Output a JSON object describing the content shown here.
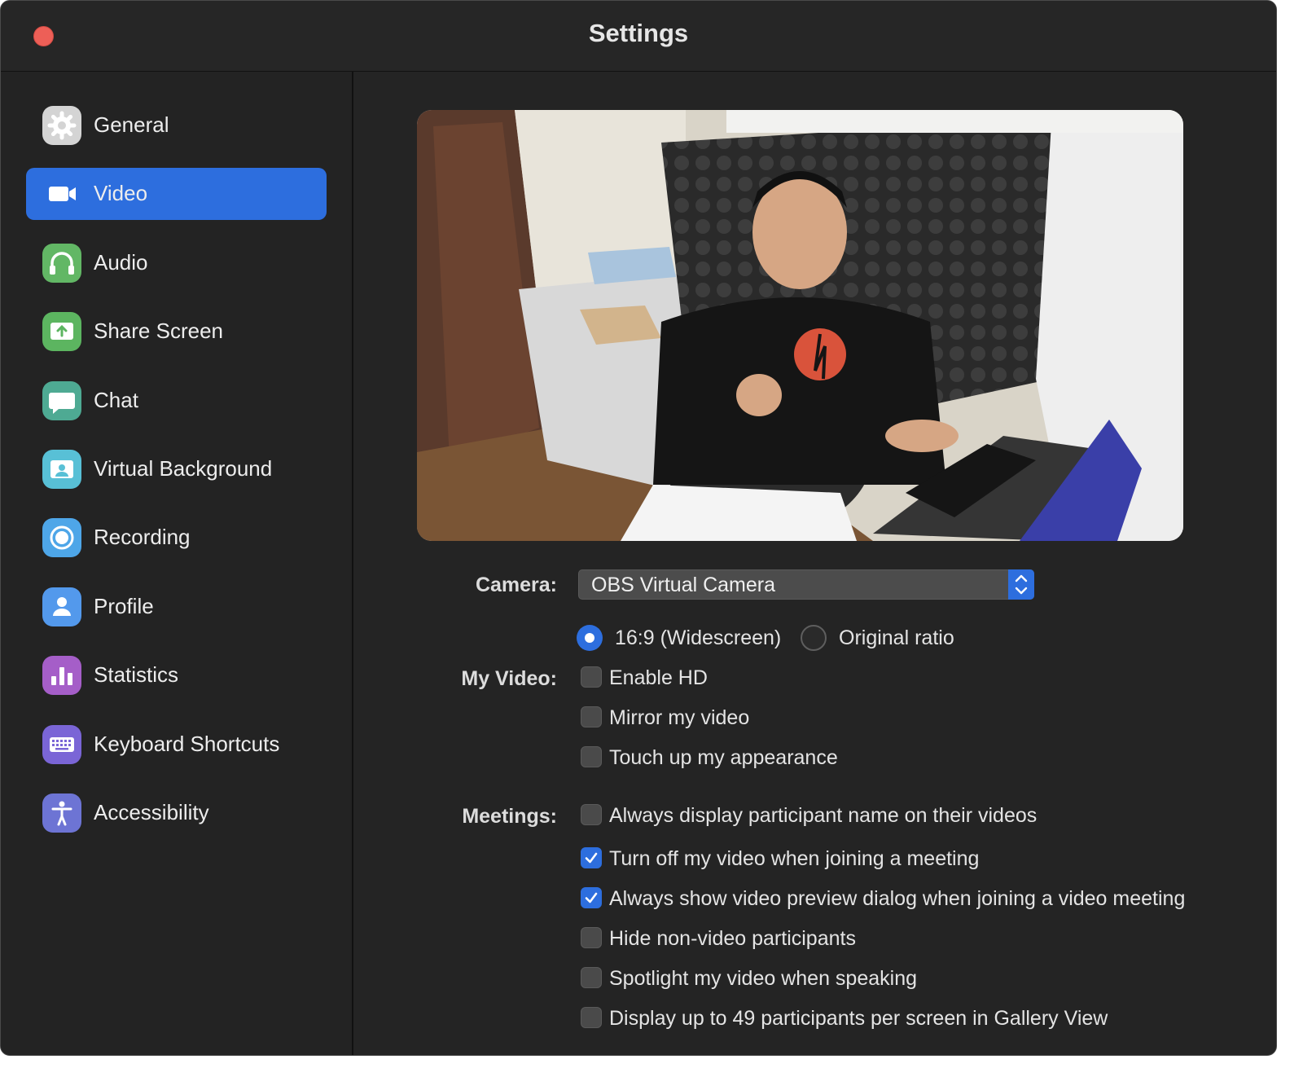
{
  "window": {
    "title": "Settings"
  },
  "sidebar": {
    "items": [
      {
        "label": "General",
        "icon": "gear-icon",
        "color": "#d6d6d6",
        "active": false
      },
      {
        "label": "Video",
        "icon": "video-camera-icon",
        "color": "#2d6ede",
        "active": true
      },
      {
        "label": "Audio",
        "icon": "headphones-icon",
        "color": "#62b765",
        "active": false
      },
      {
        "label": "Share Screen",
        "icon": "share-screen-icon",
        "color": "#5cb560",
        "active": false
      },
      {
        "label": "Chat",
        "icon": "chat-bubble-icon",
        "color": "#4eaa93",
        "active": false
      },
      {
        "label": "Virtual Background",
        "icon": "virtual-background-icon",
        "color": "#58c0d6",
        "active": false
      },
      {
        "label": "Recording",
        "icon": "record-icon",
        "color": "#4ea6e8",
        "active": false
      },
      {
        "label": "Profile",
        "icon": "person-icon",
        "color": "#5399ec",
        "active": false
      },
      {
        "label": "Statistics",
        "icon": "bar-chart-icon",
        "color": "#a55ec8",
        "active": false
      },
      {
        "label": "Keyboard Shortcuts",
        "icon": "keyboard-icon",
        "color": "#7a65d6",
        "active": false
      },
      {
        "label": "Accessibility",
        "icon": "accessibility-icon",
        "color": "#6d74d4",
        "active": false
      }
    ]
  },
  "video": {
    "camera_label": "Camera:",
    "camera_value": "OBS Virtual Camera",
    "ratio_options": [
      {
        "label": "16:9 (Widescreen)",
        "selected": true
      },
      {
        "label": "Original ratio",
        "selected": false
      }
    ],
    "my_video_label": "My Video:",
    "my_video_options": [
      {
        "label": "Enable HD",
        "checked": false
      },
      {
        "label": "Mirror my video",
        "checked": false
      },
      {
        "label": "Touch up my appearance",
        "checked": false
      }
    ],
    "meetings_label": "Meetings:",
    "meetings_options": [
      {
        "label": "Always display participant name on their videos",
        "checked": false
      },
      {
        "label": "Turn off my video when joining a meeting",
        "checked": true
      },
      {
        "label": "Always show video preview dialog when joining a video meeting",
        "checked": true
      },
      {
        "label": "Hide non-video participants",
        "checked": false
      },
      {
        "label": "Spotlight my video when speaking",
        "checked": false
      },
      {
        "label": "Display up to 49 participants per screen in Gallery View",
        "checked": false
      }
    ]
  },
  "colors": {
    "accent": "#2d6ede",
    "background": "#242424",
    "close_button": "#ed5f57"
  }
}
